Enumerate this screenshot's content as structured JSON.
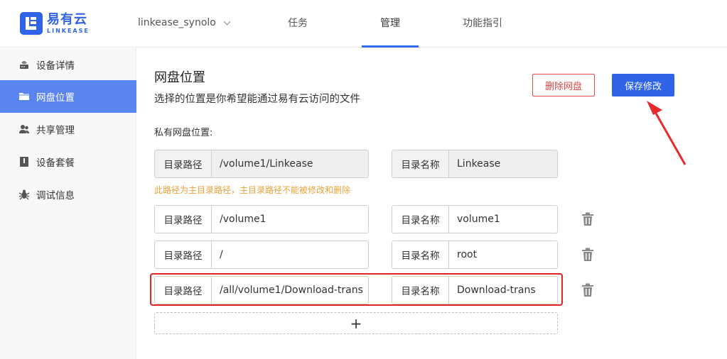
{
  "header": {
    "logo_cn": "易有云",
    "logo_en": "LINKEASE",
    "device": "linkease_synolo",
    "tabs": [
      {
        "label": "任务"
      },
      {
        "label": "管理"
      },
      {
        "label": "功能指引"
      }
    ],
    "accent": "#2f6af0"
  },
  "sidebar": {
    "items": [
      {
        "label": "设备详情",
        "icon": "router-icon"
      },
      {
        "label": "网盘位置",
        "icon": "folder-icon"
      },
      {
        "label": "共享管理",
        "icon": "users-icon"
      },
      {
        "label": "设备套餐",
        "icon": "package-icon"
      },
      {
        "label": "调试信息",
        "icon": "bug-icon"
      }
    ],
    "active_color": "#5a85f0"
  },
  "main": {
    "title": "网盘位置",
    "subtitle": "选择的位置是你希望能通过易有云访问的文件",
    "section_label": "私有网盘位置:",
    "delete_button": "删除网盘",
    "save_button": "保存修改",
    "warning": "此路径为主目录路径，主目录路径不能被修改和删除",
    "path_label": "目录路径",
    "name_label": "目录名称",
    "rows": [
      {
        "path": "/volume1/Linkease",
        "name": "Linkease"
      },
      {
        "path": "/volume1",
        "name": "volume1"
      },
      {
        "path": "/",
        "name": "root"
      },
      {
        "path": "/all/volume1/Download-trans",
        "name": "Download-trans"
      }
    ],
    "add_symbol": "+"
  }
}
